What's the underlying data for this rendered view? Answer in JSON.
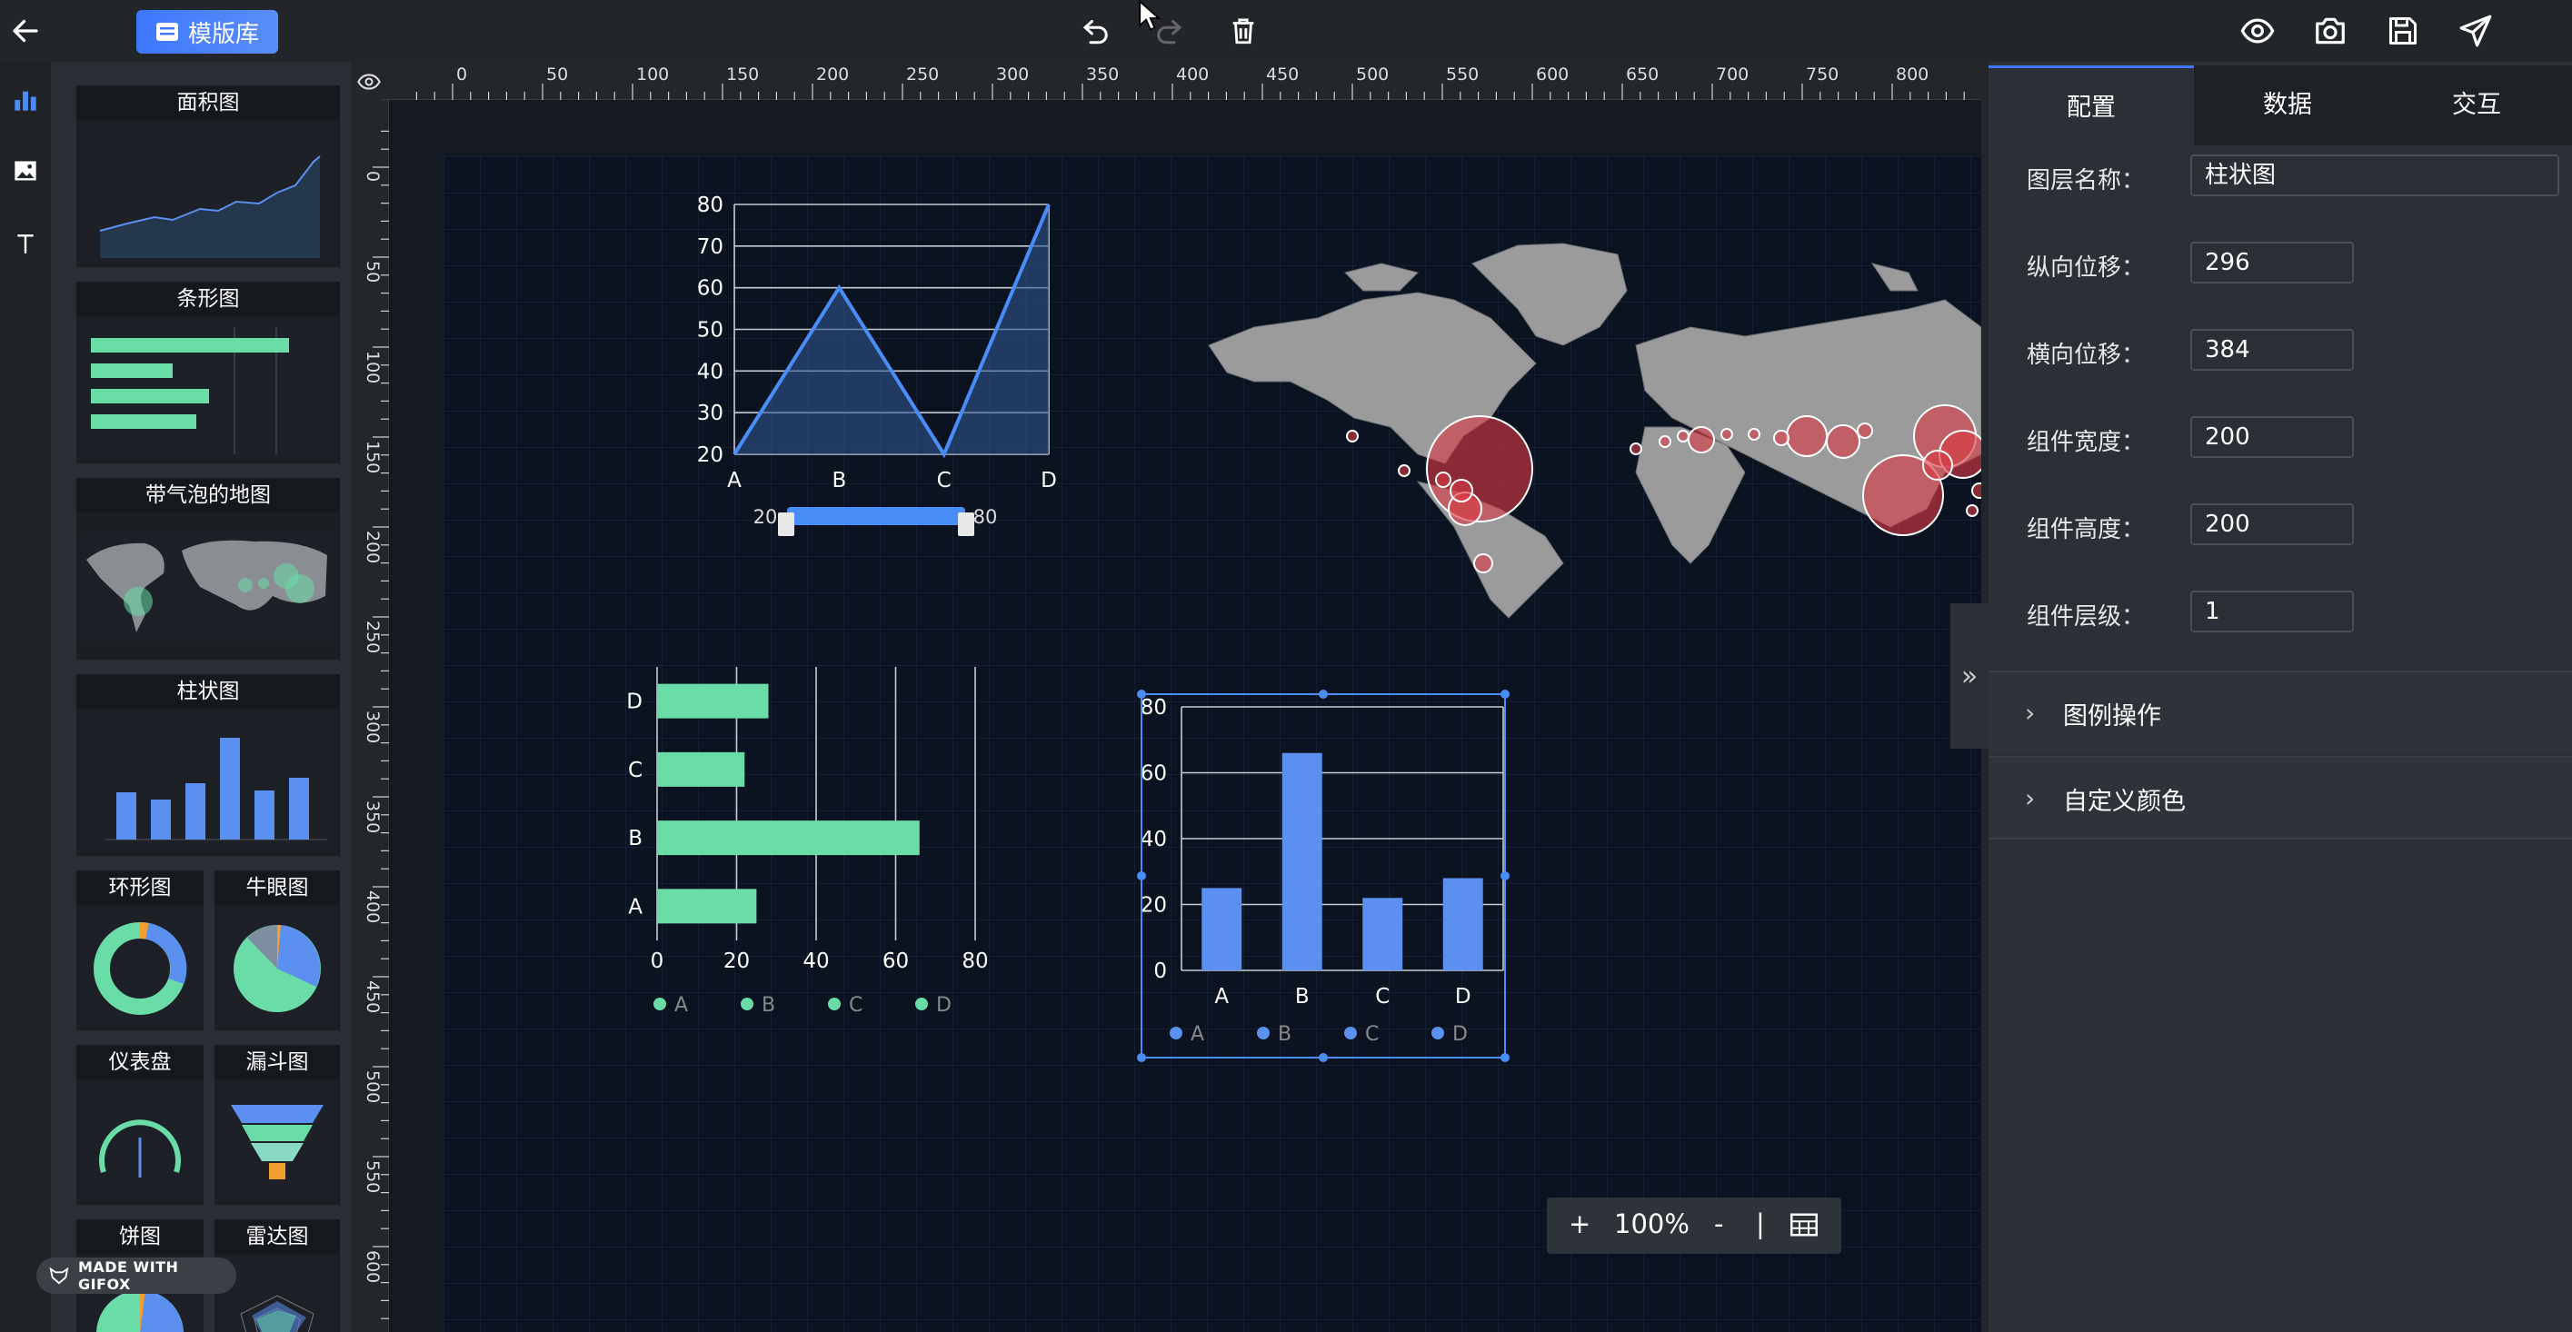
{
  "toolbar": {
    "back_icon": "arrow-left-icon",
    "template_library_label": "模版库",
    "actions": [
      "undo-icon",
      "redo-icon",
      "delete-icon"
    ],
    "right_actions": [
      "preview-eye-icon",
      "screenshot-camera-icon",
      "save-icon",
      "publish-send-icon"
    ]
  },
  "left_strip": {
    "items": [
      "chart-icon",
      "image-icon",
      "text-icon"
    ]
  },
  "templates": [
    {
      "label": "面积图"
    },
    {
      "label": "条形图"
    },
    {
      "label": "带气泡的地图"
    },
    {
      "label": "柱状图"
    },
    {
      "label": "环形图"
    },
    {
      "label": "牛眼图"
    },
    {
      "label": "仪表盘"
    },
    {
      "label": "漏斗图"
    },
    {
      "label": "饼图"
    },
    {
      "label": "雷达图"
    }
  ],
  "ruler": {
    "top_ticks": [
      "0",
      "50",
      "100",
      "150",
      "200",
      "250",
      "300",
      "350",
      "400",
      "450",
      "500",
      "550",
      "600",
      "650",
      "700",
      "750",
      "800",
      "8"
    ],
    "left_ticks": [
      "0",
      "50",
      "100",
      "150",
      "200",
      "250",
      "300",
      "350",
      "400",
      "450",
      "500",
      "550",
      "600"
    ]
  },
  "chart_data": [
    {
      "type": "area",
      "categories": [
        "A",
        "B",
        "C",
        "D"
      ],
      "values": [
        20,
        60,
        20,
        80
      ],
      "ylim": [
        20,
        80
      ],
      "yticks": [
        "80",
        "70",
        "60",
        "50",
        "40",
        "30",
        "20"
      ],
      "slider": {
        "min_label": "20",
        "max_label": "80"
      },
      "color": "#4a8df8"
    },
    {
      "type": "bar",
      "orientation": "horizontal",
      "categories": [
        "D",
        "C",
        "B",
        "A"
      ],
      "values": [
        28,
        22,
        66,
        25
      ],
      "xlim": [
        0,
        80
      ],
      "xticks": [
        "0",
        "20",
        "40",
        "60",
        "80"
      ],
      "legend": [
        "A",
        "B",
        "C",
        "D"
      ],
      "legend_position": "bottom",
      "color": "#69dca7"
    },
    {
      "type": "bar",
      "categories": [
        "A",
        "B",
        "C",
        "D"
      ],
      "values": [
        25,
        66,
        22,
        28
      ],
      "ylim": [
        0,
        80
      ],
      "yticks": [
        "80",
        "60",
        "40",
        "20",
        "0"
      ],
      "legend": [
        "A",
        "B",
        "C",
        "D"
      ],
      "legend_position": "bottom",
      "color": "#5b8ff0"
    }
  ],
  "properties": {
    "tabs": [
      "配置",
      "数据",
      "交互"
    ],
    "active_tab": "配置",
    "fields": [
      {
        "label": "图层名称：",
        "value": "柱状图"
      },
      {
        "label": "纵向位移：",
        "value": "296"
      },
      {
        "label": "横向位移：",
        "value": "384"
      },
      {
        "label": "组件宽度：",
        "value": "200"
      },
      {
        "label": "组件高度：",
        "value": "200"
      },
      {
        "label": "组件层级：",
        "value": "1"
      }
    ],
    "sections": [
      "图例操作",
      "自定义颜色"
    ]
  },
  "zoom": {
    "plus": "+",
    "level": "100%",
    "minus": "-",
    "divider": "|"
  },
  "watermark": "MADE WITH GIFOX",
  "colors": {
    "accent": "#3d77ff",
    "bar_green": "#69dca7",
    "bar_blue": "#5b8ff0",
    "bubble_red": "#e0444c",
    "map_gray": "#9b9b9b"
  }
}
